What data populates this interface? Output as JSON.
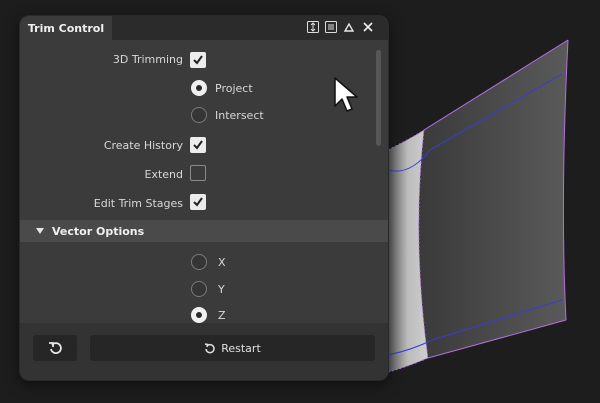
{
  "panel": {
    "title": "Trim Control",
    "titlebar_icons": [
      "resize-vertical-icon",
      "menu-icon",
      "collapse-up-icon",
      "close-icon"
    ]
  },
  "options": {
    "trimming_3d": {
      "label": "3D Trimming",
      "checked": true
    },
    "mode": {
      "selected": "Project",
      "choices": [
        {
          "label": "Project",
          "selected": true
        },
        {
          "label": "Intersect",
          "selected": false
        }
      ]
    },
    "create_history": {
      "label": "Create History",
      "checked": true
    },
    "extend": {
      "label": "Extend",
      "checked": false
    },
    "edit_trim_stages": {
      "label": "Edit Trim Stages",
      "checked": true
    }
  },
  "vector_options": {
    "header": "Vector Options",
    "choices": [
      {
        "label": "X",
        "selected": false
      },
      {
        "label": "Y",
        "selected": false
      },
      {
        "label": "Z",
        "selected": true
      }
    ]
  },
  "footer": {
    "reset_icon": "undo-icon",
    "restart_label": "Restart"
  },
  "colors": {
    "panel_bg": "#3b3b3b",
    "surface_outline": "#b070e0",
    "surface_curve": "#3a3adc"
  }
}
